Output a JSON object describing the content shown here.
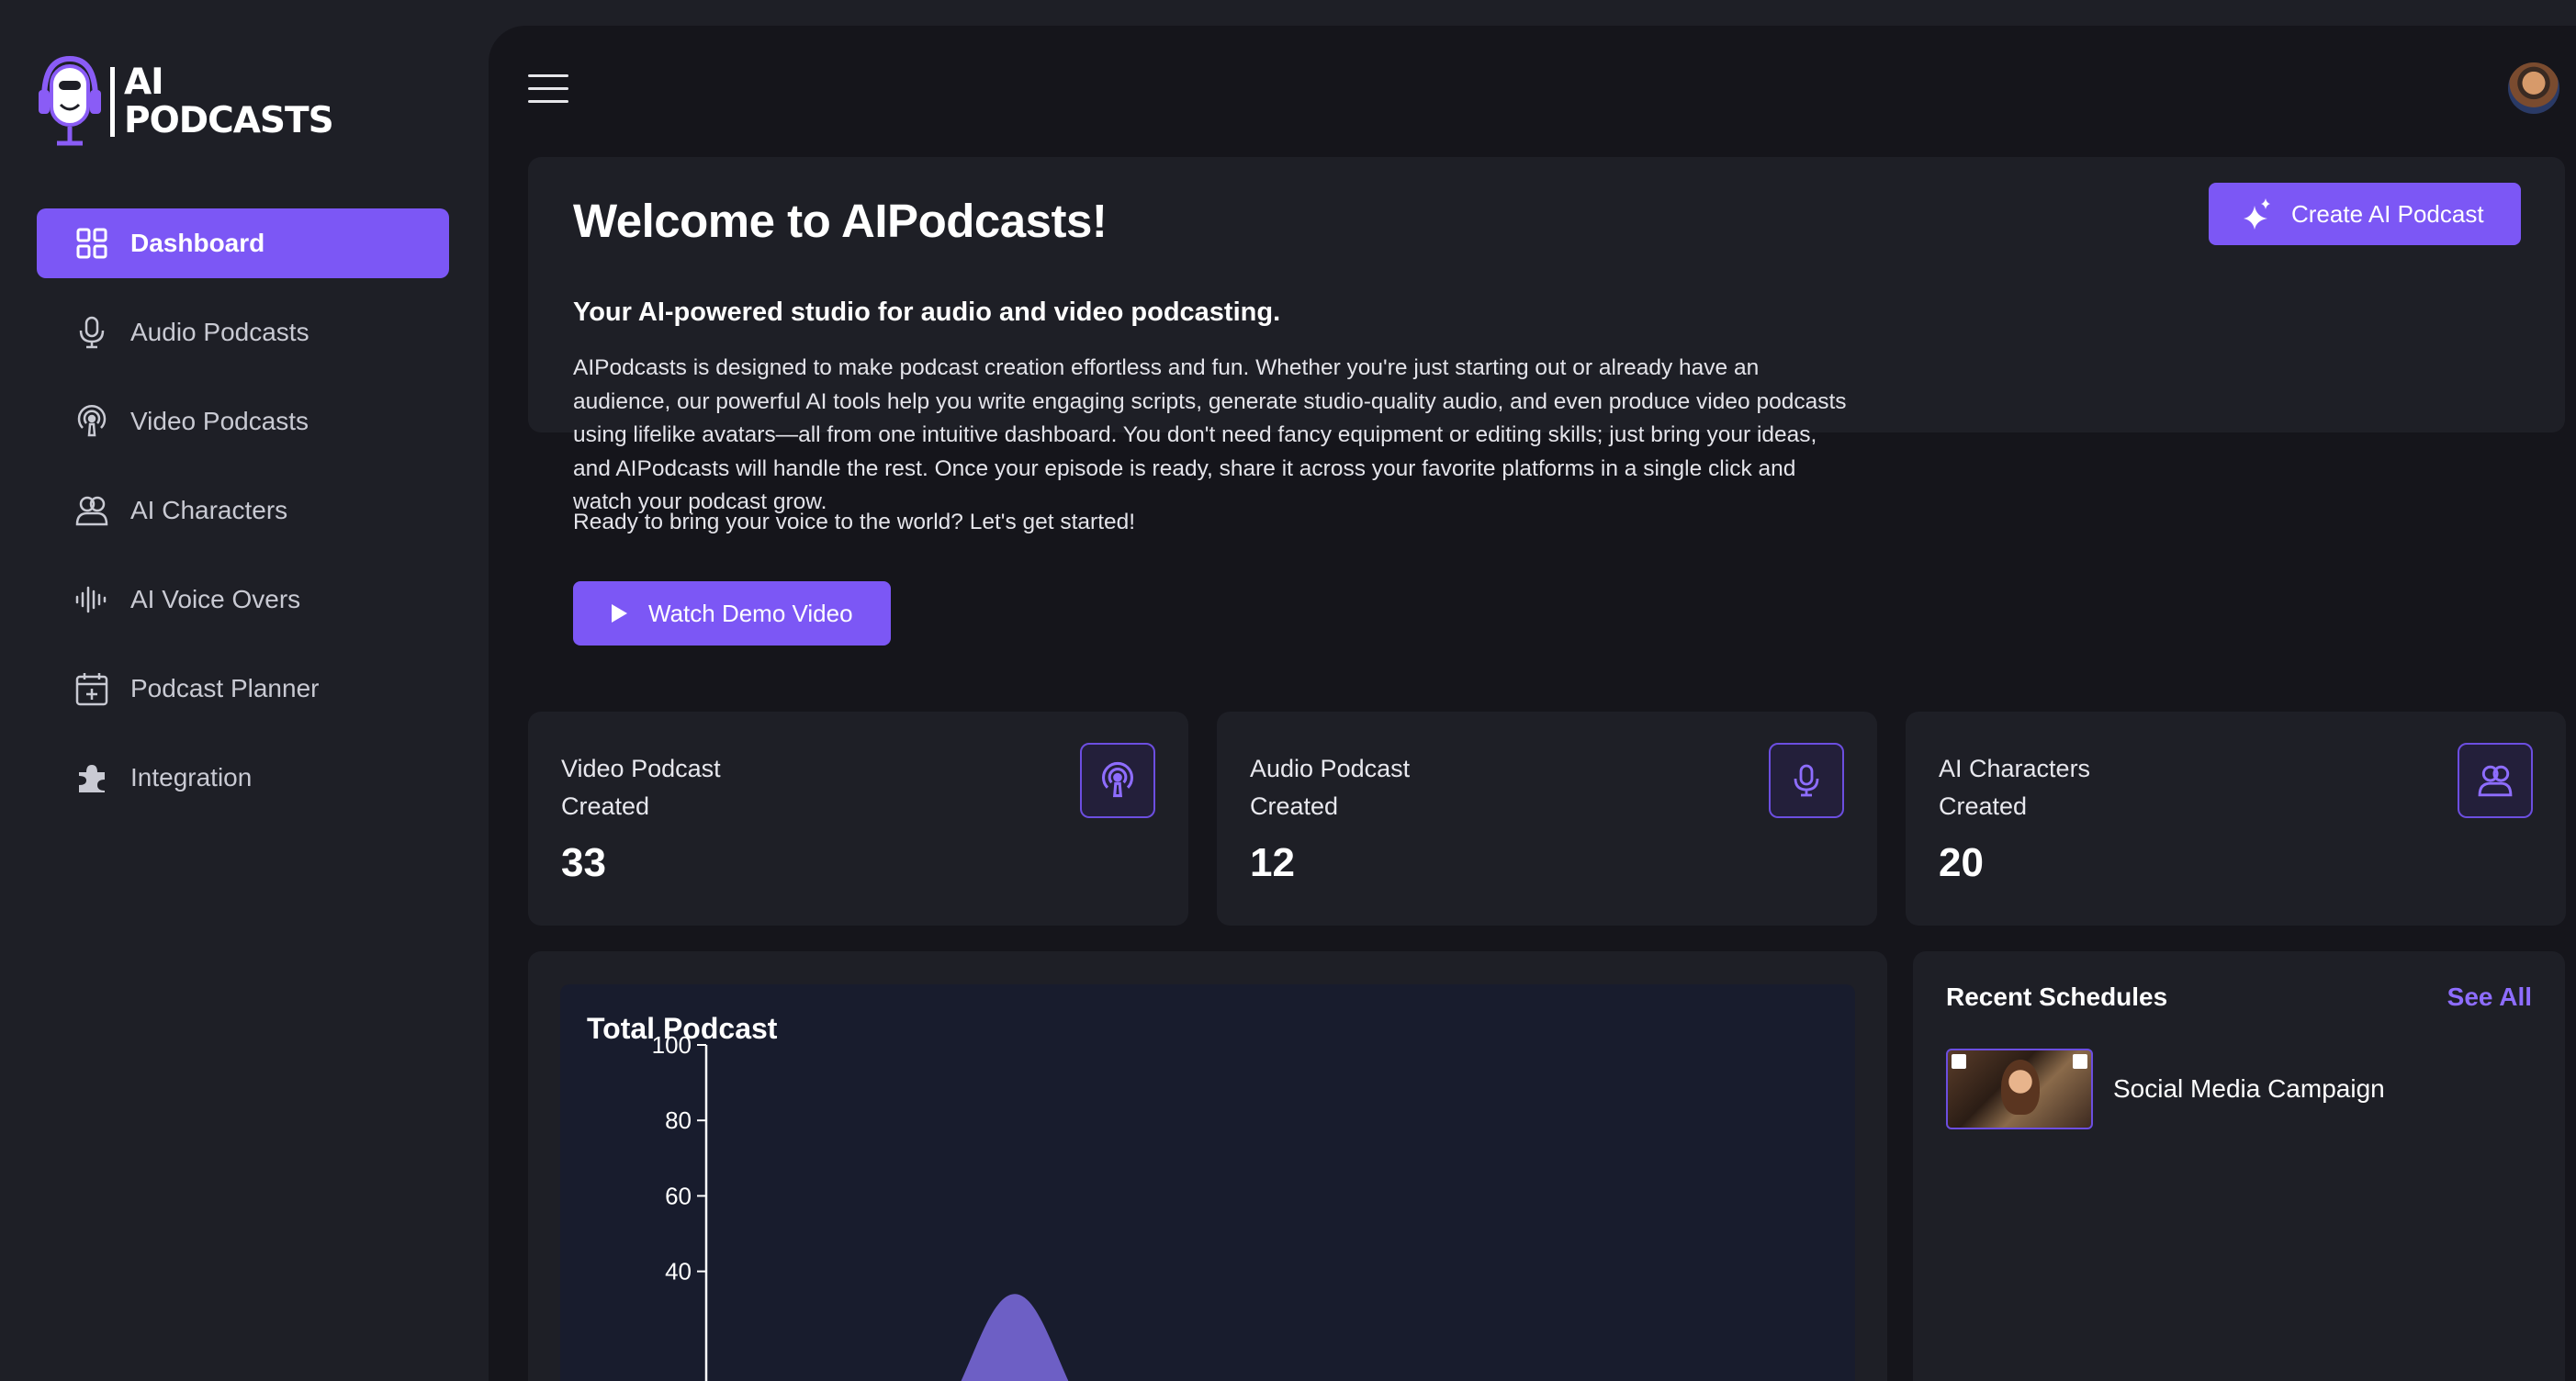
{
  "brand": {
    "line1": "AI",
    "line2": "PODCASTS"
  },
  "sidebar": {
    "items": [
      {
        "label": "Dashboard",
        "icon": "grid-icon",
        "active": true
      },
      {
        "label": "Audio Podcasts",
        "icon": "microphone-icon"
      },
      {
        "label": "Video Podcasts",
        "icon": "podcast-icon"
      },
      {
        "label": "AI Characters",
        "icon": "users-icon"
      },
      {
        "label": "AI Voice Overs",
        "icon": "waveform-icon"
      },
      {
        "label": "Podcast Planner",
        "icon": "calendar-plus-icon"
      },
      {
        "label": "Integration",
        "icon": "puzzle-icon"
      }
    ]
  },
  "welcome": {
    "title": "Welcome to AIPodcasts!",
    "subtitle": "Your AI-powered studio for audio and video podcasting.",
    "body": "AIPodcasts is designed to make podcast creation effortless and fun. Whether you're just starting out or already have an audience, our powerful AI tools help you write engaging scripts, generate studio-quality audio, and even produce video podcasts using lifelike avatars—all from one intuitive dashboard. You don't need fancy equipment or editing skills; just bring your ideas, and AIPodcasts will handle the rest. Once your episode is ready, share it across your favorite platforms in a single click and watch your podcast grow.",
    "ready": "Ready to bring your voice to the world? Let's get started!",
    "demo_button": "Watch Demo Video",
    "create_button": "Create AI Podcast"
  },
  "stats": [
    {
      "line1": "Video Podcast",
      "line2": "Created",
      "value": "33",
      "icon": "podcast-icon"
    },
    {
      "line1": "Audio Podcast",
      "line2": "Created",
      "value": "12",
      "icon": "microphone-icon"
    },
    {
      "line1": "AI Characters",
      "line2": "Created",
      "value": "20",
      "icon": "users-icon"
    }
  ],
  "chart_data": {
    "type": "area",
    "title": "Total Podcast",
    "yticks": [
      "100",
      "80",
      "60",
      "40"
    ],
    "ylim": [
      0,
      100
    ],
    "visible_peak": 34,
    "color": "#7c6be0"
  },
  "schedules": {
    "title": "Recent Schedules",
    "see_all": "See All",
    "items": [
      {
        "name": "Social Media Campaign"
      }
    ]
  },
  "colors": {
    "accent": "#7c57f5",
    "background": "#15151b",
    "card": "#1e1f26"
  }
}
